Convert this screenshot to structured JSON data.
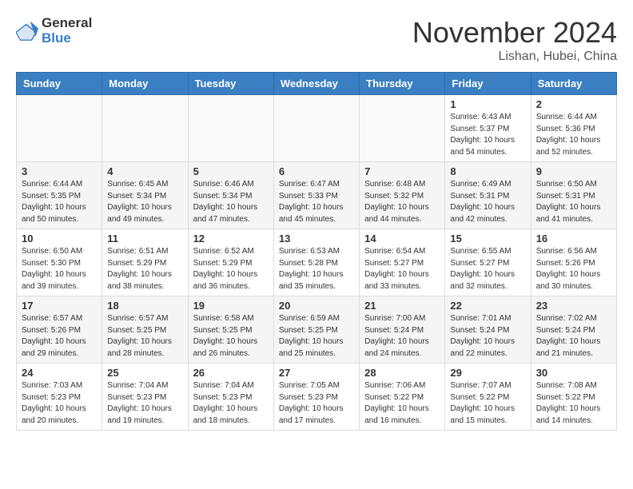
{
  "header": {
    "logo_line1": "General",
    "logo_line2": "Blue",
    "month_title": "November 2024",
    "location": "Lishan, Hubei, China"
  },
  "days_of_week": [
    "Sunday",
    "Monday",
    "Tuesday",
    "Wednesday",
    "Thursday",
    "Friday",
    "Saturday"
  ],
  "weeks": [
    [
      {
        "day": "",
        "empty": true
      },
      {
        "day": "",
        "empty": true
      },
      {
        "day": "",
        "empty": true
      },
      {
        "day": "",
        "empty": true
      },
      {
        "day": "",
        "empty": true
      },
      {
        "day": "1",
        "sunrise": "6:43 AM",
        "sunset": "5:37 PM",
        "daylight": "10 hours and 54 minutes."
      },
      {
        "day": "2",
        "sunrise": "6:44 AM",
        "sunset": "5:36 PM",
        "daylight": "10 hours and 52 minutes."
      }
    ],
    [
      {
        "day": "3",
        "sunrise": "6:44 AM",
        "sunset": "5:35 PM",
        "daylight": "10 hours and 50 minutes."
      },
      {
        "day": "4",
        "sunrise": "6:45 AM",
        "sunset": "5:34 PM",
        "daylight": "10 hours and 49 minutes."
      },
      {
        "day": "5",
        "sunrise": "6:46 AM",
        "sunset": "5:34 PM",
        "daylight": "10 hours and 47 minutes."
      },
      {
        "day": "6",
        "sunrise": "6:47 AM",
        "sunset": "5:33 PM",
        "daylight": "10 hours and 45 minutes."
      },
      {
        "day": "7",
        "sunrise": "6:48 AM",
        "sunset": "5:32 PM",
        "daylight": "10 hours and 44 minutes."
      },
      {
        "day": "8",
        "sunrise": "6:49 AM",
        "sunset": "5:31 PM",
        "daylight": "10 hours and 42 minutes."
      },
      {
        "day": "9",
        "sunrise": "6:50 AM",
        "sunset": "5:31 PM",
        "daylight": "10 hours and 41 minutes."
      }
    ],
    [
      {
        "day": "10",
        "sunrise": "6:50 AM",
        "sunset": "5:30 PM",
        "daylight": "10 hours and 39 minutes."
      },
      {
        "day": "11",
        "sunrise": "6:51 AM",
        "sunset": "5:29 PM",
        "daylight": "10 hours and 38 minutes."
      },
      {
        "day": "12",
        "sunrise": "6:52 AM",
        "sunset": "5:29 PM",
        "daylight": "10 hours and 36 minutes."
      },
      {
        "day": "13",
        "sunrise": "6:53 AM",
        "sunset": "5:28 PM",
        "daylight": "10 hours and 35 minutes."
      },
      {
        "day": "14",
        "sunrise": "6:54 AM",
        "sunset": "5:27 PM",
        "daylight": "10 hours and 33 minutes."
      },
      {
        "day": "15",
        "sunrise": "6:55 AM",
        "sunset": "5:27 PM",
        "daylight": "10 hours and 32 minutes."
      },
      {
        "day": "16",
        "sunrise": "6:56 AM",
        "sunset": "5:26 PM",
        "daylight": "10 hours and 30 minutes."
      }
    ],
    [
      {
        "day": "17",
        "sunrise": "6:57 AM",
        "sunset": "5:26 PM",
        "daylight": "10 hours and 29 minutes."
      },
      {
        "day": "18",
        "sunrise": "6:57 AM",
        "sunset": "5:25 PM",
        "daylight": "10 hours and 28 minutes."
      },
      {
        "day": "19",
        "sunrise": "6:58 AM",
        "sunset": "5:25 PM",
        "daylight": "10 hours and 26 minutes."
      },
      {
        "day": "20",
        "sunrise": "6:59 AM",
        "sunset": "5:25 PM",
        "daylight": "10 hours and 25 minutes."
      },
      {
        "day": "21",
        "sunrise": "7:00 AM",
        "sunset": "5:24 PM",
        "daylight": "10 hours and 24 minutes."
      },
      {
        "day": "22",
        "sunrise": "7:01 AM",
        "sunset": "5:24 PM",
        "daylight": "10 hours and 22 minutes."
      },
      {
        "day": "23",
        "sunrise": "7:02 AM",
        "sunset": "5:24 PM",
        "daylight": "10 hours and 21 minutes."
      }
    ],
    [
      {
        "day": "24",
        "sunrise": "7:03 AM",
        "sunset": "5:23 PM",
        "daylight": "10 hours and 20 minutes."
      },
      {
        "day": "25",
        "sunrise": "7:04 AM",
        "sunset": "5:23 PM",
        "daylight": "10 hours and 19 minutes."
      },
      {
        "day": "26",
        "sunrise": "7:04 AM",
        "sunset": "5:23 PM",
        "daylight": "10 hours and 18 minutes."
      },
      {
        "day": "27",
        "sunrise": "7:05 AM",
        "sunset": "5:23 PM",
        "daylight": "10 hours and 17 minutes."
      },
      {
        "day": "28",
        "sunrise": "7:06 AM",
        "sunset": "5:22 PM",
        "daylight": "10 hours and 16 minutes."
      },
      {
        "day": "29",
        "sunrise": "7:07 AM",
        "sunset": "5:22 PM",
        "daylight": "10 hours and 15 minutes."
      },
      {
        "day": "30",
        "sunrise": "7:08 AM",
        "sunset": "5:22 PM",
        "daylight": "10 hours and 14 minutes."
      }
    ]
  ],
  "labels": {
    "sunrise": "Sunrise:",
    "sunset": "Sunset:",
    "daylight": "Daylight:"
  }
}
